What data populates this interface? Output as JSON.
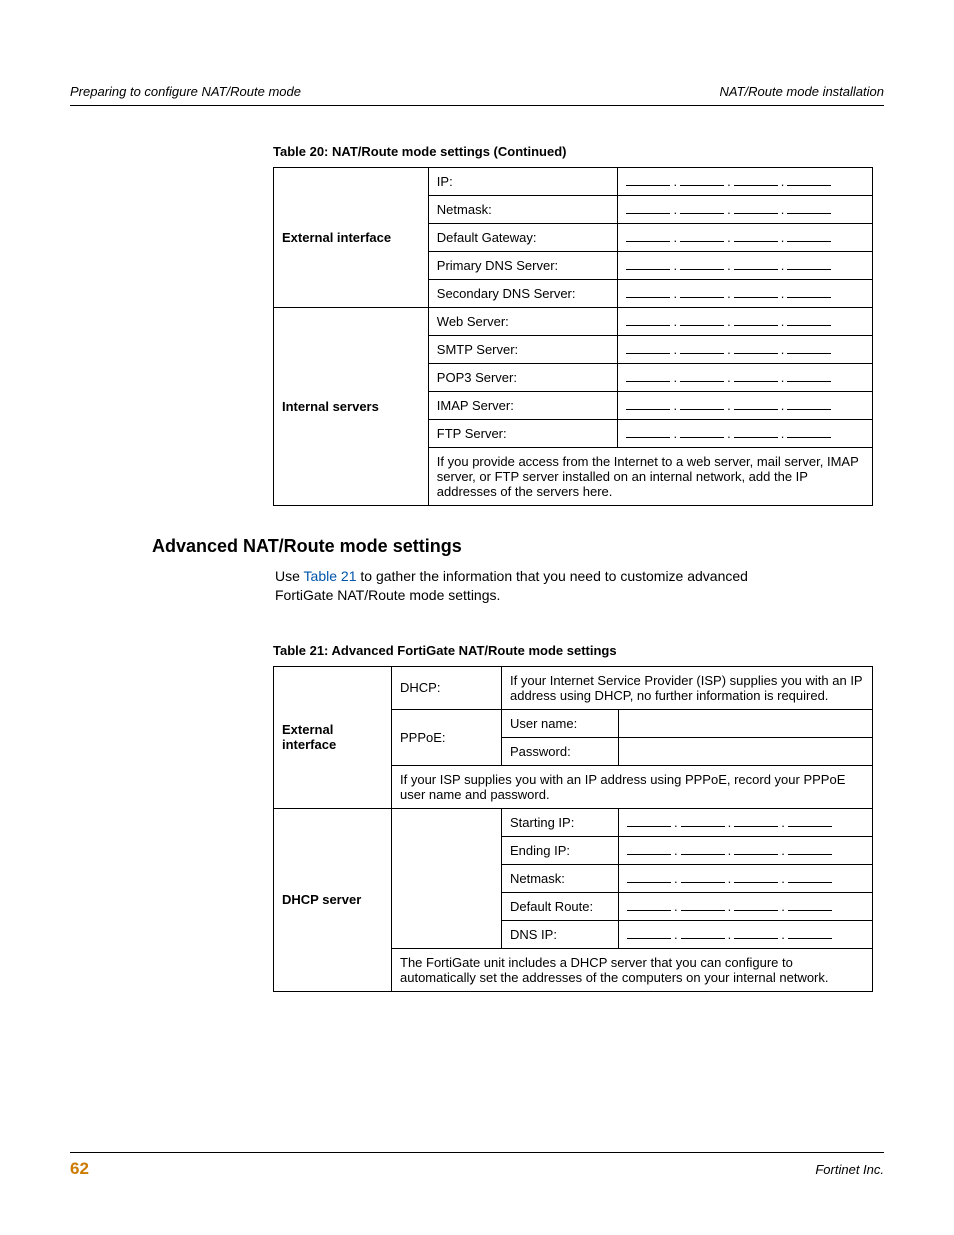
{
  "header": {
    "left": "Preparing to configure NAT/Route mode",
    "right": "NAT/Route mode installation"
  },
  "table20": {
    "caption": "Table 20: NAT/Route mode settings  (Continued)",
    "ext_label": "External interface",
    "ext_rows": {
      "ip": "IP:",
      "netmask": "Netmask:",
      "gateway": "Default Gateway:",
      "pdns": "Primary DNS Server:",
      "sdns": "Secondary DNS Server:"
    },
    "int_label": "Internal servers",
    "int_rows": {
      "web": "Web Server:",
      "smtp": "SMTP Server:",
      "pop3": "POP3 Server:",
      "imap": "IMAP Server:",
      "ftp": "FTP Server:"
    },
    "int_note": "If you provide access from the Internet to a web server, mail server, IMAP server, or FTP server installed on an internal network, add the IP addresses of the servers here."
  },
  "section": {
    "heading": "Advanced NAT/Route mode settings",
    "body_pre": "Use ",
    "body_link": "Table 21",
    "body_post": " to gather the information that you need to customize advanced FortiGate NAT/Route mode settings."
  },
  "table21": {
    "caption": "Table 21: Advanced FortiGate NAT/Route mode settings",
    "extif_label": "External interface",
    "dhcp_label": "DHCP:",
    "dhcp_text": "If your Internet Service Provider (ISP) supplies you with an IP address using DHCP, no further information is required.",
    "pppoe_label": "PPPoE:",
    "pppoe_user": "User name:",
    "pppoe_pass": "Password:",
    "pppoe_note": "If your ISP supplies you with an IP address using PPPoE, record your PPPoE user name and password.",
    "dhcpserver_label": "DHCP server",
    "ds_rows": {
      "start": "Starting IP:",
      "end": "Ending IP:",
      "netmask": "Netmask:",
      "route": "Default Route:",
      "dns": "DNS IP:"
    },
    "ds_note": "The FortiGate unit includes a DHCP server that you can configure to automatically set the addresses of the computers on your internal network."
  },
  "footer": {
    "page": "62",
    "right": "Fortinet Inc."
  }
}
